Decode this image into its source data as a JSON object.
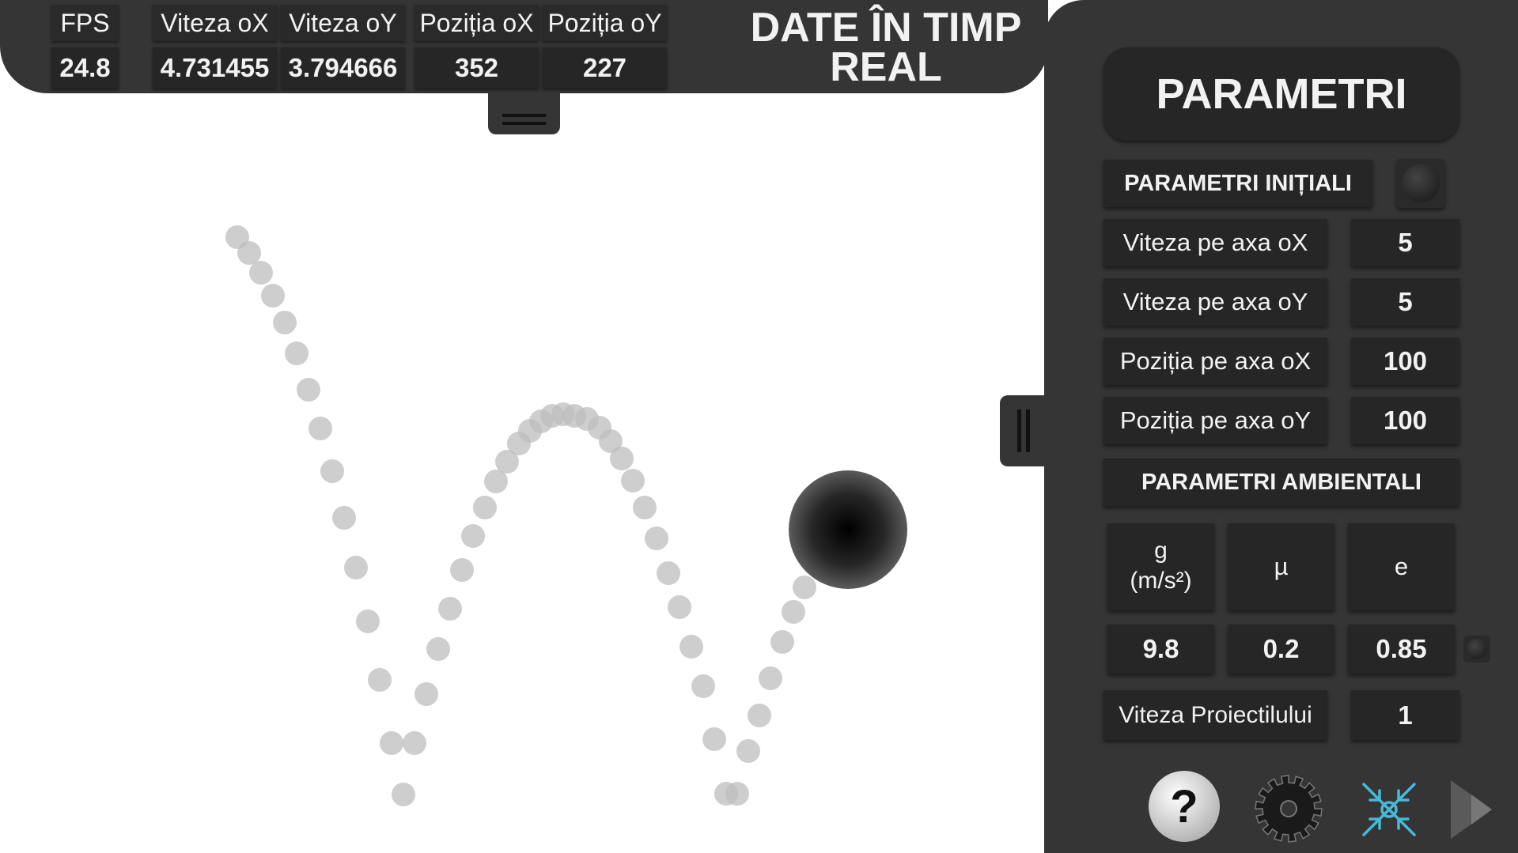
{
  "realtime": {
    "title_line1": "DATE ÎN TIMP",
    "title_line2": "REAL",
    "stats": [
      {
        "label": "FPS",
        "value": "24.8"
      },
      {
        "label": "Viteza oX",
        "value": "4.731455"
      },
      {
        "label": "Viteza oY",
        "value": "3.794666"
      },
      {
        "label": "Poziția oX",
        "value": "352"
      },
      {
        "label": "Poziția oY",
        "value": "227"
      }
    ]
  },
  "panel": {
    "title": "PARAMETRI",
    "initial_section": "PARAMETRI INIȚIALI",
    "initial": [
      {
        "label": "Viteza pe axa oX",
        "value": "5"
      },
      {
        "label": "Viteza pe axa oY",
        "value": "5"
      },
      {
        "label": "Poziția pe axa oX",
        "value": "100"
      },
      {
        "label": "Poziția pe axa oY",
        "value": "100"
      }
    ],
    "ambient_section": "PARAMETRI AMBIENTALI",
    "ambient": {
      "g_label_line1": "g",
      "g_label_line2": "(m/s²)",
      "mu_label": "µ",
      "e_label": "e",
      "g_value": "9.8",
      "mu_value": "0.2",
      "e_value": "0.85"
    },
    "projectile_speed_label": "Viteza Proiectilului",
    "projectile_speed_value": "1",
    "help_glyph": "?",
    "icons": [
      "help-icon",
      "gear-icon",
      "collapse-arrows-icon",
      "play-arrow-icon"
    ]
  },
  "colors": {
    "panel_bg": "#353535",
    "field_bg": "#262626",
    "text": "#f2f2f2",
    "trail": "#bdbdbd",
    "accent_icon": "#47b9d9"
  }
}
